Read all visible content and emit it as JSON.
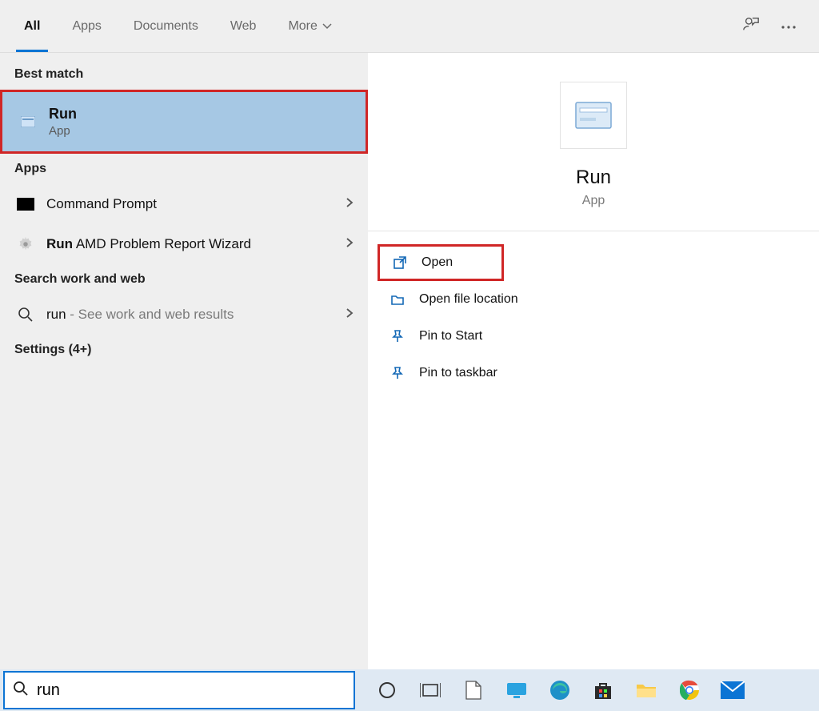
{
  "header": {
    "tabs": [
      {
        "label": "All",
        "active": true
      },
      {
        "label": "Apps",
        "active": false
      },
      {
        "label": "Documents",
        "active": false
      },
      {
        "label": "Web",
        "active": false
      },
      {
        "label": "More",
        "active": false,
        "chevron": true
      }
    ]
  },
  "left": {
    "best_match_label": "Best match",
    "best_match": {
      "title": "Run",
      "subtitle": "App"
    },
    "apps_label": "Apps",
    "apps": [
      {
        "title": "Command Prompt",
        "bold_prefix": ""
      },
      {
        "title_prefix_bold": "Run",
        "title_rest": " AMD Problem Report Wizard"
      }
    ],
    "work_web_label": "Search work and web",
    "work_web_item": {
      "query": "run",
      "suffix": " - See work and web results"
    },
    "settings_label": "Settings (4+)"
  },
  "preview": {
    "title": "Run",
    "subtitle": "App",
    "actions": [
      {
        "label": "Open",
        "icon": "open",
        "highlighted": true
      },
      {
        "label": "Open file location",
        "icon": "folder"
      },
      {
        "label": "Pin to Start",
        "icon": "pin"
      },
      {
        "label": "Pin to taskbar",
        "icon": "pin"
      }
    ]
  },
  "search_value": "run"
}
